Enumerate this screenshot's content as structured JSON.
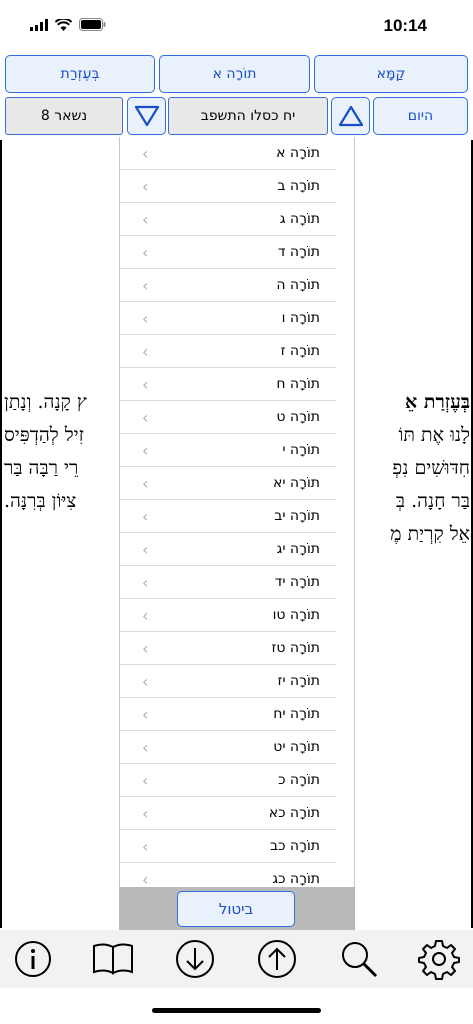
{
  "status": {
    "time": "10:14"
  },
  "header": {
    "btn_right": "קַמָּא",
    "btn_center": "תוֹרָה א",
    "btn_left": "בְּעֶזְרַת",
    "today_label": "היום",
    "date_text": "יח כסלו התשפב",
    "remaining_text": "נשאר 8"
  },
  "text": {
    "right_lines": [
      "בְּעֶזְרַת אֵ",
      "לָנוּ אֶת תּוֹ",
      "חִדּוּשִׁים נִפְ",
      "בַּר חָנָה. בְּ",
      "אֵל קִרְיַת מֶ"
    ],
    "left_lines": [
      "ץ קָנָה. וְנָתַן",
      "זִיל לְהַדְפִּיס",
      "רֵי רַבָּה בַּר",
      "צִיּוֹן בְּרִנָּה.",
      ""
    ]
  },
  "list": {
    "items": [
      "תוֹרָה א",
      "תוֹרָה ב",
      "תוֹרָה ג",
      "תוֹרָה ד",
      "תוֹרָה ה",
      "תוֹרָה ו",
      "תוֹרָה ז",
      "תוֹרָה ח",
      "תוֹרָה ט",
      "תוֹרָה י",
      "תוֹרָה יא",
      "תוֹרָה יב",
      "תוֹרָה יג",
      "תוֹרָה יד",
      "תוֹרָה טו",
      "תוֹרָה טז",
      "תוֹרָה יז",
      "תוֹרָה יח",
      "תוֹרָה יט",
      "תוֹרָה כ",
      "תוֹרָה כא",
      "תוֹרָה כב",
      "תוֹרָה כג"
    ],
    "cancel_label": "ביטול"
  },
  "icons": [
    "info-icon",
    "book-icon",
    "arrow-down-icon",
    "arrow-up-icon",
    "search-icon",
    "gear-icon"
  ],
  "colors": {
    "accent": "#2f6fe0",
    "button_bg": "#e8f1fc",
    "footer_bg": "#b9b9b9"
  }
}
